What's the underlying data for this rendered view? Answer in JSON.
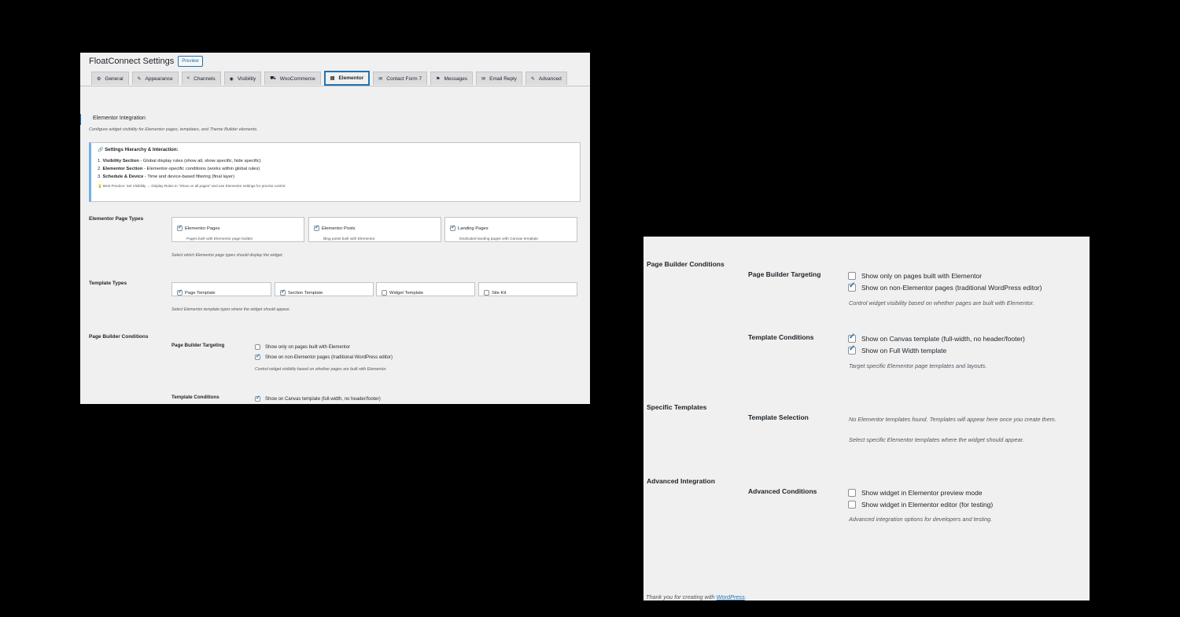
{
  "header": {
    "title": "FloatConnect Settings",
    "preview_label": "Preview"
  },
  "tabs": [
    {
      "label": "General",
      "icon": "⚙"
    },
    {
      "label": "Appearance",
      "icon": "✎"
    },
    {
      "label": "Channels",
      "icon": "<"
    },
    {
      "label": "Visibility",
      "icon": "◉"
    },
    {
      "label": "WooCommerce",
      "icon": "⛟"
    },
    {
      "label": "Elementor",
      "icon": "▤"
    },
    {
      "label": "Contact Form 7",
      "icon": "✉"
    },
    {
      "label": "Messages",
      "icon": "⚑"
    },
    {
      "label": "Email Reply",
      "icon": "✉"
    },
    {
      "label": "Advanced",
      "icon": "✎"
    }
  ],
  "section": {
    "heading": "Elementor Integration",
    "description": "Configure widget visibility for Elementor pages, templates, and Theme Builder elements."
  },
  "notice": {
    "title": "🔗 Settings Hierarchy & Interaction:",
    "items": [
      {
        "num": "1.",
        "bold": "Visibility Section",
        "text": " - Global display rules (show all, show specific, hide specific)"
      },
      {
        "num": "2.",
        "bold": "Elementor Section",
        "text": " - Elementor-specific conditions (works within global rules)"
      },
      {
        "num": "3.",
        "bold": "Schedule & Device",
        "text": " - Time and device-based filtering (final layer)"
      }
    ],
    "tip": "💡 Best Practice: Set Visibility → Display Rules to \"Show on all pages\" and use Elementor settings for precise control."
  },
  "page_types": {
    "label": "Elementor Page Types",
    "cards": [
      {
        "label": "Elementor Pages",
        "desc": "Pages built with Elementor page builder",
        "checked": true
      },
      {
        "label": "Elementor Posts",
        "desc": "Blog posts built with Elementor",
        "checked": true
      },
      {
        "label": "Landing Pages",
        "desc": "Dedicated landing pages with Canvas template",
        "checked": true
      }
    ],
    "hint": "Select which Elementor page types should display the widget."
  },
  "template_types": {
    "label": "Template Types",
    "cards": [
      {
        "label": "Page Template",
        "checked": true
      },
      {
        "label": "Section Template",
        "checked": true
      },
      {
        "label": "Widget Template",
        "checked": false
      },
      {
        "label": "Site Kit",
        "checked": false
      }
    ],
    "hint": "Select Elementor template types where the widget should appear."
  },
  "page_builder": {
    "label": "Page Builder Conditions",
    "targeting": {
      "label": "Page Builder Targeting",
      "options": [
        {
          "label": "Show only on pages built with Elementor",
          "checked": false
        },
        {
          "label": "Show on non-Elementor pages (traditional WordPress editor)",
          "checked": true
        }
      ],
      "hint": "Control widget visibility based on whether pages are built with Elementor."
    },
    "template_conditions": {
      "label": "Template Conditions",
      "options": [
        {
          "label": "Show on Canvas template (full-width, no header/footer)",
          "checked": true
        },
        {
          "label": "Show on Full Width template",
          "checked": true
        }
      ],
      "hint": "Target specific Elementor page templates and layouts."
    }
  },
  "specific_templates": {
    "label": "Specific Templates",
    "selection_label": "Template Selection",
    "empty_text": "No Elementor templates found. Templates will appear here once you create them.",
    "hint": "Select specific Elementor templates where the widget should appear."
  },
  "advanced": {
    "label": "Advanced Integration",
    "conditions_label": "Advanced Conditions",
    "options": [
      {
        "label": "Show widget in Elementor preview mode",
        "checked": false
      },
      {
        "label": "Show widget in Elementor editor (for testing)",
        "checked": false
      }
    ],
    "hint": "Advanced integration options for developers and testing."
  },
  "footer": {
    "text": "Thank you for creating with ",
    "link": "WordPress",
    "end": "."
  },
  "colors": {
    "accent": "#2271b1",
    "panel_bg": "#f0f0f1",
    "background": "#000000"
  }
}
